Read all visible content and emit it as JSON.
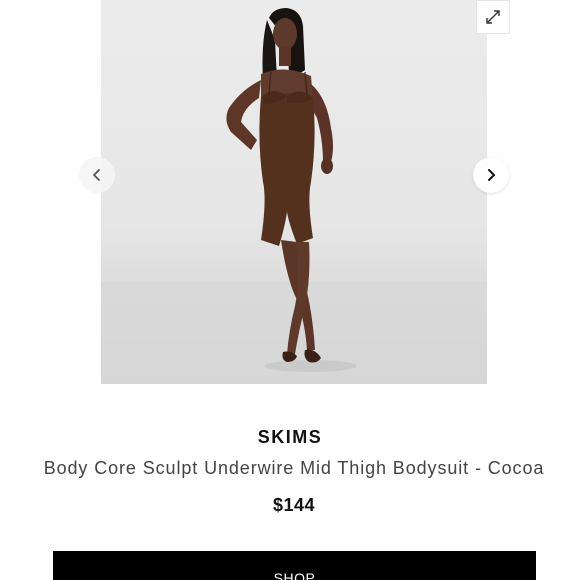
{
  "gallery": {
    "expand_icon": "expand-arrows-icon",
    "prev_icon": "chevron-left-icon",
    "next_icon": "chevron-right-icon",
    "photo_subject": "model-wearing-bodysuit"
  },
  "product": {
    "brand": "SKIMS",
    "name": "Body Core Sculpt Underwire Mid Thigh Bodysuit - Cocoa",
    "price": "$144"
  },
  "actions": {
    "shop_label": "SHOP"
  },
  "colors": {
    "product_color": "#5a3327",
    "button_bg": "#000000",
    "button_text": "#ffffff",
    "text_primary": "#111111",
    "text_secondary": "#444444"
  }
}
